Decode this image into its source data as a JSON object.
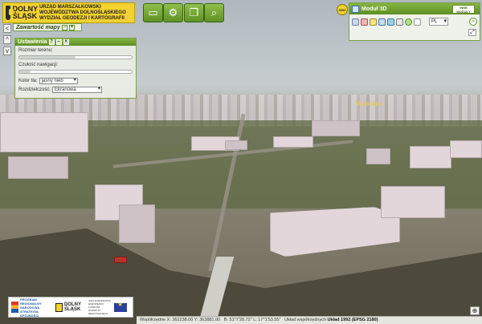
{
  "header": {
    "logo_name": "DOLNY ŚLĄSK",
    "logo_office": "URZĄD MARSZAŁKOWSKI WOJEWÓDZTWA DOLNOŚLĄSKIEGO WYDZIAŁ GEODEZJI I KARTOGRAFII",
    "toolbar": [
      {
        "name": "folder",
        "icon": "folder-icon"
      },
      {
        "name": "settings",
        "icon": "gears-icon"
      },
      {
        "name": "windows",
        "icon": "windows-icon"
      },
      {
        "name": "search",
        "icon": "search-icon"
      }
    ]
  },
  "module3d": {
    "zoom_badge": "0000",
    "title": "Moduł 3D",
    "other_modules": "INNE MODUŁY",
    "language": "PL",
    "next_symbol": "»",
    "zoom_symbol": "⤢"
  },
  "left": {
    "toc_title": "Zawartość mapy",
    "nav": [
      "<",
      "^",
      "v"
    ]
  },
  "settings": {
    "title": "Ustawienia",
    "terrain_label": "Rozmiar terenu:",
    "terrain_value": 0.5,
    "nav_label": "Czułość nawigacji:",
    "nav_value": 0.1,
    "bg_label": "Kolor tła:",
    "bg_value": "jasny nieb",
    "res_label": "Rozdzielczość:",
    "res_value": "Ekranowa"
  },
  "map": {
    "city_label": "Wrocław"
  },
  "footer": {
    "logo1": "PROGRAM REGIONALNY NARODOWA STRATEGIA SPÓJNOŚCI",
    "logo2": "DOLNY ŚLĄSK",
    "logo3": "UNIA EUROPEJSKA EUROPEJSKI FUNDUSZ ROZWOJU REGIONALNEGO",
    "status_prefix": "Współrzędne X: 362238.00 Y: 363881.00",
    "status_geo": "B: 51°7'28.72\" L: 17°1'53.55\"",
    "status_system_label": "Układ współrzędnych",
    "status_system": "Układ 1992 (EPSG 2180)"
  }
}
